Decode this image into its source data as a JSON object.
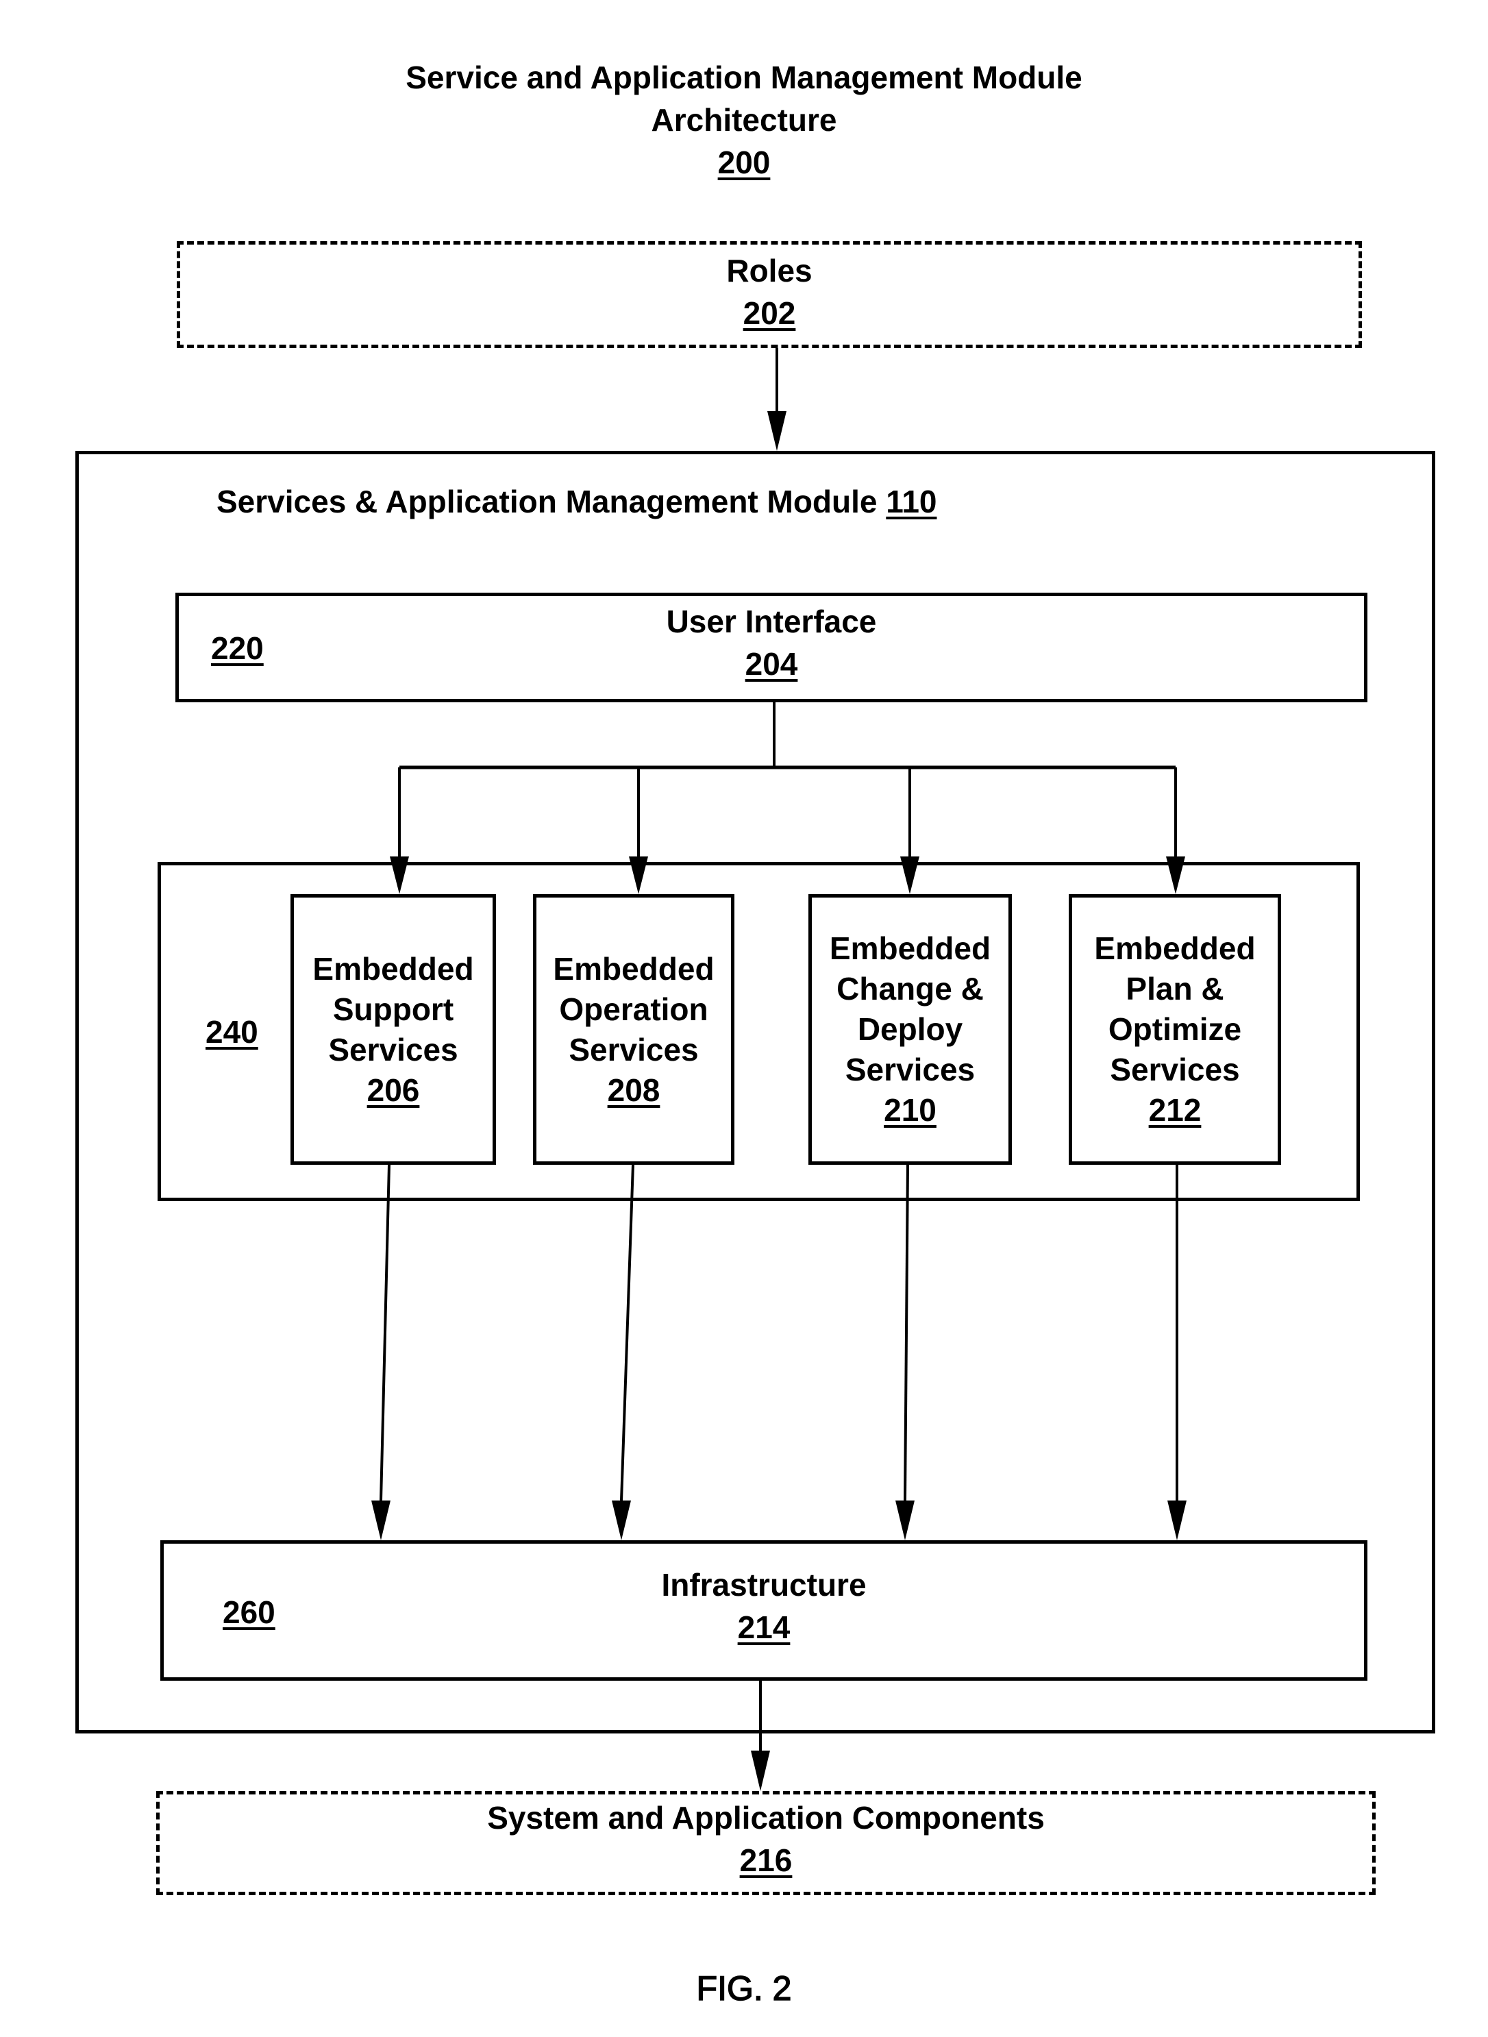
{
  "figure": {
    "title_line1": "Service and Application Management Module",
    "title_line2": "Architecture",
    "ref": "200",
    "caption": "FIG. 2"
  },
  "roles": {
    "label": "Roles",
    "ref": "202"
  },
  "module": {
    "label": "Services & Application Management Module",
    "ref": "110"
  },
  "ui_layer": {
    "layer_ref": "220",
    "label": "User Interface",
    "ref": "204"
  },
  "services_layer": {
    "layer_ref": "240",
    "services": [
      {
        "lines": [
          "Embedded",
          "Support",
          "Services"
        ],
        "ref": "206"
      },
      {
        "lines": [
          "Embedded",
          "Operation",
          "Services"
        ],
        "ref": "208"
      },
      {
        "lines": [
          "Embedded",
          "Change &",
          "Deploy",
          "Services"
        ],
        "ref": "210"
      },
      {
        "lines": [
          "Embedded",
          "Plan &",
          "Optimize",
          "Services"
        ],
        "ref": "212"
      }
    ]
  },
  "infra_layer": {
    "layer_ref": "260",
    "label": "Infrastructure",
    "ref": "214"
  },
  "components": {
    "label": "System and Application Components",
    "ref": "216"
  },
  "connections": [
    {
      "from": "202",
      "to": "110"
    },
    {
      "from": "204",
      "to": "206"
    },
    {
      "from": "204",
      "to": "208"
    },
    {
      "from": "204",
      "to": "210"
    },
    {
      "from": "204",
      "to": "212"
    },
    {
      "from": "206",
      "to": "214"
    },
    {
      "from": "208",
      "to": "214"
    },
    {
      "from": "210",
      "to": "214"
    },
    {
      "from": "212",
      "to": "214"
    },
    {
      "from": "214",
      "to": "216"
    }
  ]
}
